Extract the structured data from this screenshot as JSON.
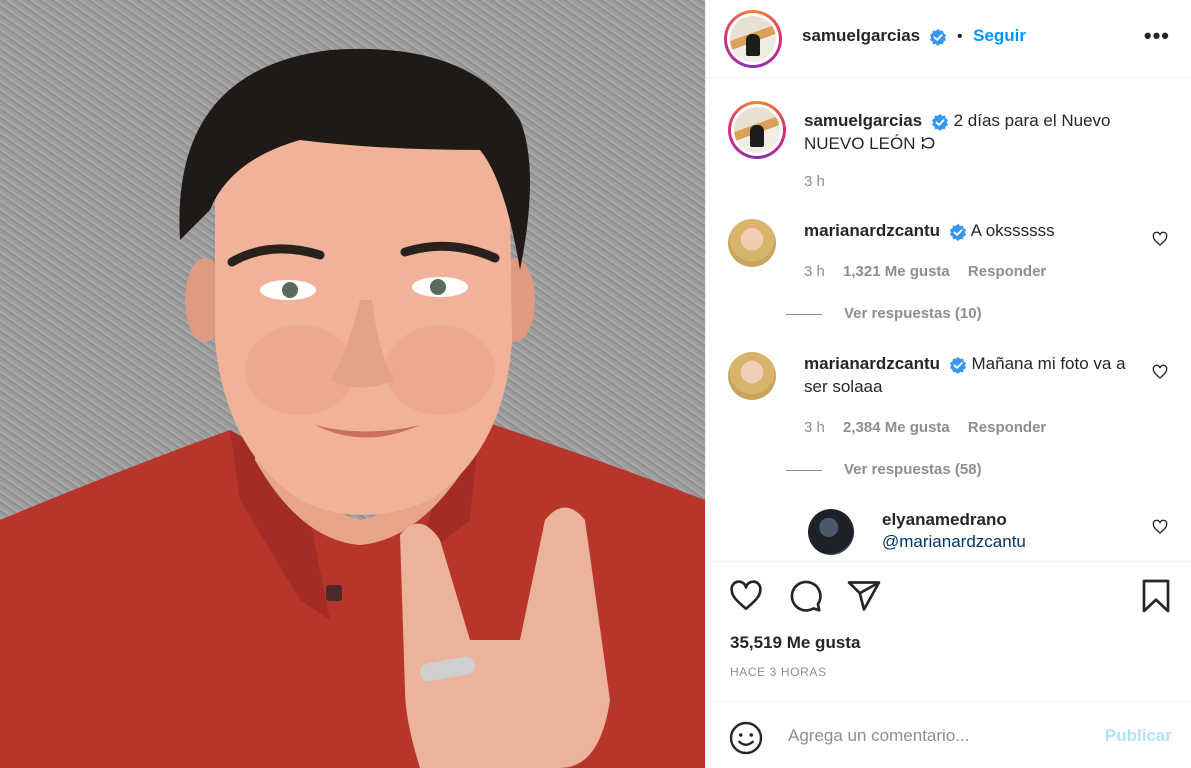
{
  "post": {
    "photo_alt": "selfie"
  },
  "header": {
    "username": "samuelgarcias",
    "separator": "•",
    "follow_label": "Seguir",
    "more_label": "•••"
  },
  "caption": {
    "username": "samuelgarcias",
    "text": "2 días para el Nuevo NUEVO LEÓN 𝈀",
    "time": "3 h"
  },
  "comments": [
    {
      "username": "marianardzcantu",
      "text": "A okssssss",
      "time": "3 h",
      "likes": "1,321 Me gusta",
      "reply_label": "Responder",
      "view_replies": "Ver respuestas (10)"
    },
    {
      "username": "marianardzcantu",
      "text": "Mañana mi foto va a ser solaaa",
      "time": "3 h",
      "likes": "2,384 Me gusta",
      "reply_label": "Responder",
      "view_replies": "Ver respuestas (58)"
    }
  ],
  "reply": {
    "username": "elyanamedrano",
    "text": "@marianardzcantu"
  },
  "actions": {
    "likes": "35,519 Me gusta",
    "time": "HACE 3 HORAS"
  },
  "add_comment": {
    "placeholder": "Agrega un comentario...",
    "publish_label": "Publicar"
  },
  "colors": {
    "accent": "#0095f6",
    "publish_disabled": "#b2dffc",
    "shirt": "#b8352c",
    "muted_text": "#8e8e8e"
  },
  "icons": [
    "verified-icon",
    "more-icon",
    "heart-icon",
    "comment-icon",
    "share-icon",
    "bookmark-icon",
    "emoji-icon"
  ]
}
